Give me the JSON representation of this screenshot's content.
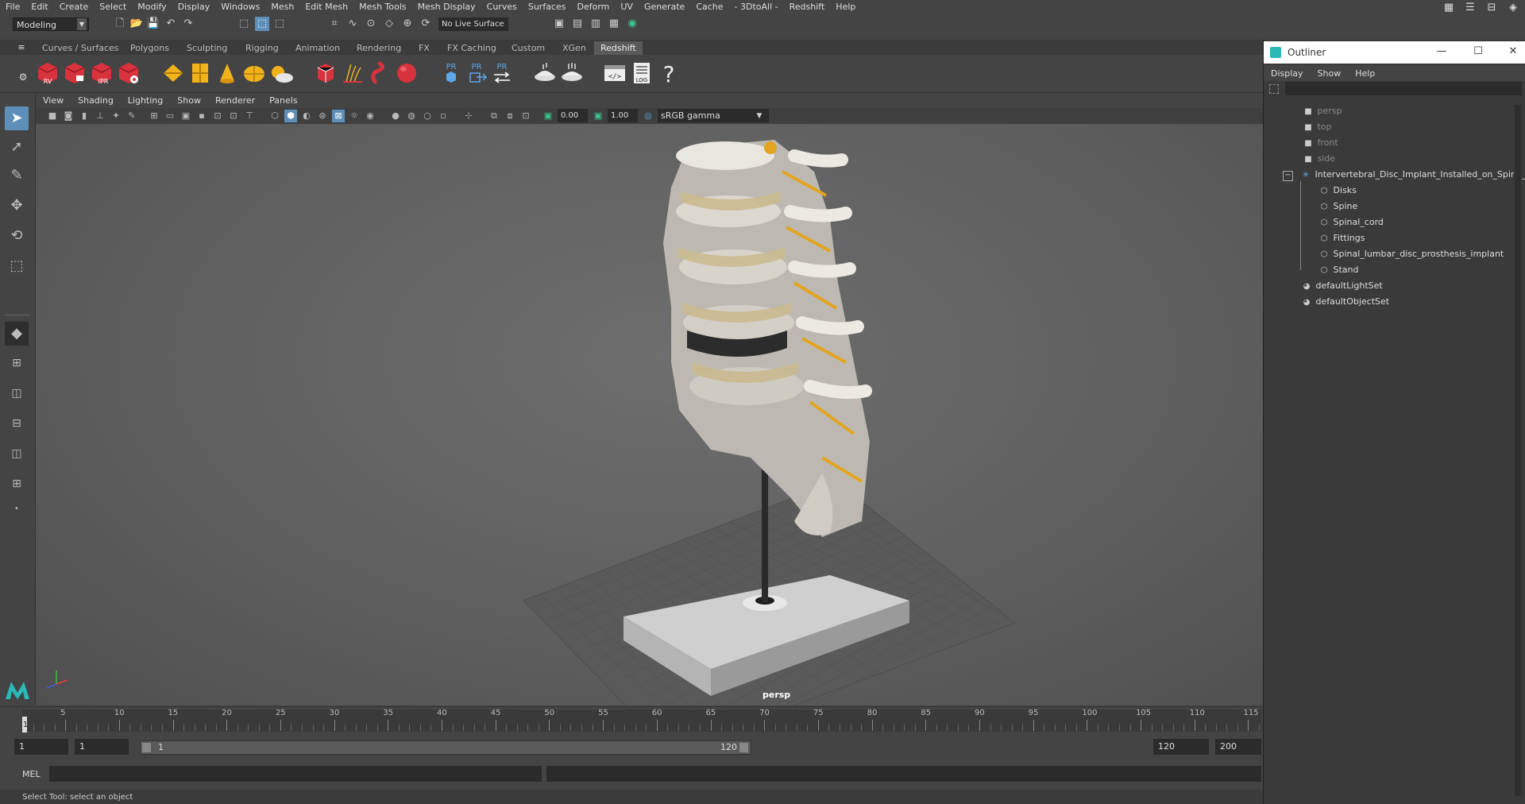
{
  "menubar": {
    "items": [
      "File",
      "Edit",
      "Create",
      "Select",
      "Modify",
      "Display",
      "Windows",
      "Mesh",
      "Edit Mesh",
      "Mesh Tools",
      "Mesh Display",
      "Curves",
      "Surfaces",
      "Deform",
      "UV",
      "Generate",
      "Cache",
      "- 3DtoAll -",
      "Redshift",
      "Help"
    ]
  },
  "statusline": {
    "mode": "Modeling",
    "live_surface": "No Live Surface"
  },
  "shelf": {
    "tabs": [
      "Curves / Surfaces",
      "Polygons",
      "Sculpting",
      "Rigging",
      "Animation",
      "Rendering",
      "FX",
      "FX Caching",
      "Custom",
      "XGen",
      "Redshift"
    ],
    "active_tab": "Redshift",
    "icon_labels": {
      "rv": "RV",
      "ipr": "IPR",
      "pr": "PR",
      "log": "LOG"
    }
  },
  "viewport": {
    "menu": [
      "View",
      "Shading",
      "Lighting",
      "Show",
      "Renderer",
      "Panels"
    ],
    "exposure": "0.00",
    "gamma_value": "1.00",
    "color_space": "sRGB gamma",
    "camera": "persp"
  },
  "timeline": {
    "ticks": [
      5,
      10,
      15,
      20,
      25,
      30,
      35,
      40,
      45,
      50,
      55,
      60,
      65,
      70,
      75,
      80,
      85,
      90,
      95,
      100,
      105,
      110,
      115
    ],
    "current_frame": "1"
  },
  "range": {
    "start": "1",
    "playback_start": "1",
    "range_start": "1",
    "range_end": "120",
    "playback_end": "120",
    "end": "200"
  },
  "mel": {
    "label": "MEL"
  },
  "helpline": {
    "text": "Select Tool: select an object"
  },
  "outliner": {
    "title": "Outliner",
    "menu": [
      "Display",
      "Show",
      "Help"
    ],
    "cameras": [
      "persp",
      "top",
      "front",
      "side"
    ],
    "group": "Intervertebral_Disc_Implant_Installed_on_Spine_r",
    "children": [
      "Disks",
      "Spine",
      "Spinal_cord",
      "Fittings",
      "Spinal_lumbar_disc_prosthesis_implant",
      "Stand"
    ],
    "sets": [
      "defaultLightSet",
      "defaultObjectSet"
    ]
  }
}
